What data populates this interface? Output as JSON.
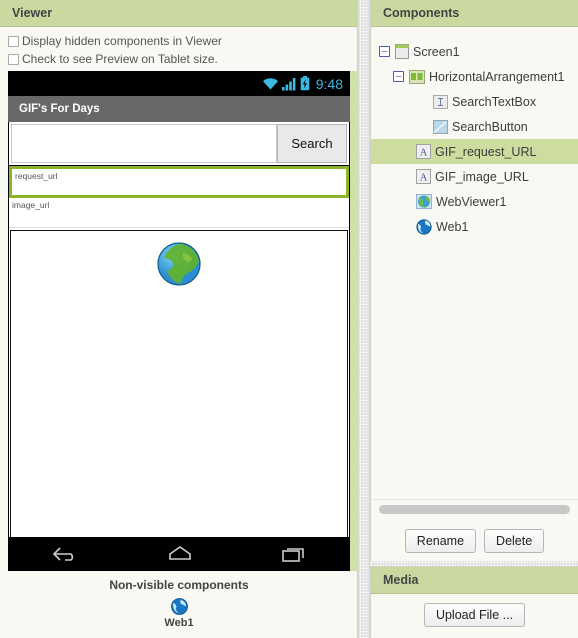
{
  "viewer": {
    "header": "Viewer",
    "checkboxes": [
      {
        "label": "Display hidden components in Viewer",
        "checked": false
      },
      {
        "label": "Check to see Preview on Tablet size.",
        "checked": false
      }
    ],
    "phone": {
      "status_bar": {
        "time": "9:48",
        "icons": [
          "wifi-icon",
          "signal-icon",
          "battery-icon"
        ],
        "accent_color": "#3bb9e0"
      },
      "app_title": "GIF's For Days",
      "search_textbox_value": "",
      "search_button_label": "Search",
      "label_request": "request_url",
      "label_image": "image_url",
      "webviewer_icon": "globe-icon",
      "nav_icons": [
        "back-icon",
        "home-icon",
        "recents-icon"
      ]
    },
    "non_visible": {
      "title": "Non-visible components",
      "items": [
        {
          "name": "Web1",
          "icon": "globe-blue-icon"
        }
      ]
    }
  },
  "components": {
    "header": "Components",
    "tree": [
      {
        "label": "Screen1",
        "depth": 0,
        "expander": "minus",
        "icon": "screen-icon",
        "selected": false
      },
      {
        "label": "HorizontalArrangement1",
        "depth": 1,
        "expander": "minus",
        "icon": "harrangement-icon",
        "selected": false
      },
      {
        "label": "SearchTextBox",
        "depth": 2,
        "expander": "none",
        "icon": "textbox-icon",
        "selected": false
      },
      {
        "label": "SearchButton",
        "depth": 2,
        "expander": "none",
        "icon": "button-icon",
        "selected": false
      },
      {
        "label": "GIF_request_URL",
        "depth": 1.5,
        "expander": "none",
        "icon": "label-icon",
        "selected": true
      },
      {
        "label": "GIF_image_URL",
        "depth": 1.5,
        "expander": "none",
        "icon": "label-icon",
        "selected": false
      },
      {
        "label": "WebViewer1",
        "depth": 1.5,
        "expander": "none",
        "icon": "webviewer-icon",
        "selected": false
      },
      {
        "label": "Web1",
        "depth": 1.5,
        "expander": "none",
        "icon": "web-icon",
        "selected": false
      }
    ],
    "buttons": {
      "rename": "Rename",
      "delete": "Delete"
    },
    "selection_color": "#ccdd9f"
  },
  "media": {
    "header": "Media",
    "upload_button": "Upload File ..."
  }
}
